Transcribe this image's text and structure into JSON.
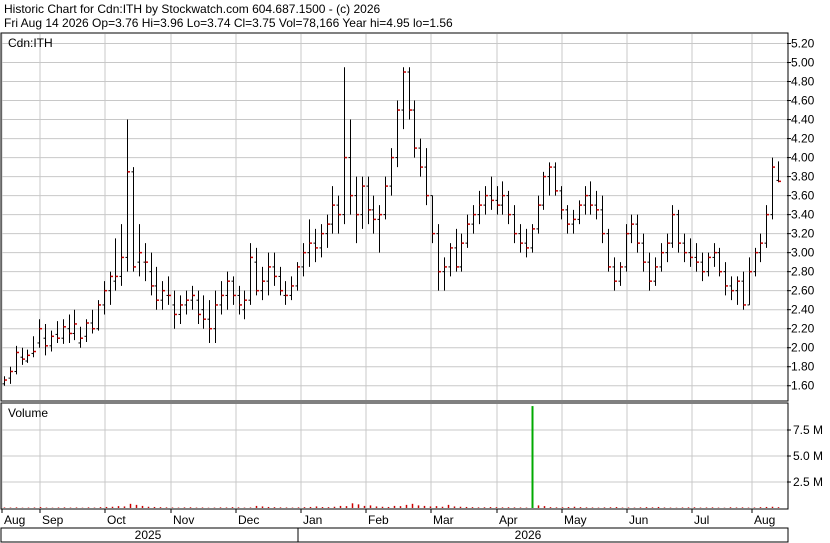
{
  "header": {
    "line1": "Historic Chart for Cdn:ITH by Stockwatch.com 604.687.1500 - (c) 2026",
    "line2": "Fri Aug 14 2026  Op=3.76  Hi=3.96  Lo=3.74  Cl=3.75  Vol=78,166  Year hi=4.95  lo=1.56"
  },
  "colors": {
    "up": "#000000",
    "close_tick": "#cc0000",
    "grid": "#c8c8c8",
    "volume_bar": "#cc0000",
    "volume_spike": "#00aa00"
  },
  "chart_data": [
    {
      "type": "ohlc",
      "title": "Cdn:ITH",
      "ylim": [
        1.45,
        5.3
      ],
      "yticks": [
        "5.20",
        "5.00",
        "4.80",
        "4.60",
        "4.40",
        "4.20",
        "4.00",
        "3.80",
        "3.60",
        "3.40",
        "3.20",
        "3.00",
        "2.80",
        "2.60",
        "2.40",
        "2.20",
        "2.00",
        "1.80",
        "1.60"
      ],
      "grid": true,
      "x_month_labels": [
        "Aug",
        "Sep",
        "Oct",
        "Nov",
        "Dec",
        "Jan",
        "Feb",
        "Mar",
        "Apr",
        "May",
        "Jun",
        "Jul",
        "Aug"
      ],
      "x_year_labels": [
        "2025",
        "2026"
      ],
      "series": [
        {
          "values": [
            [
              1.62,
              1.7,
              1.6,
              1.66
            ],
            [
              1.68,
              1.8,
              1.62,
              1.75
            ],
            [
              1.75,
              2.02,
              1.72,
              1.95
            ],
            [
              1.9,
              2.0,
              1.82,
              1.88
            ],
            [
              1.86,
              1.98,
              1.84,
              1.92
            ],
            [
              1.94,
              2.12,
              1.9,
              1.96
            ],
            [
              2.05,
              2.3,
              2.0,
              2.2
            ],
            [
              2.1,
              2.25,
              1.92,
              2.02
            ],
            [
              2.02,
              2.18,
              1.96,
              2.12
            ],
            [
              2.14,
              2.28,
              2.05,
              2.1
            ],
            [
              2.1,
              2.3,
              2.04,
              2.22
            ],
            [
              2.2,
              2.35,
              2.05,
              2.15
            ],
            [
              2.15,
              2.4,
              2.08,
              2.25
            ],
            [
              2.05,
              2.22,
              2.0,
              2.1
            ],
            [
              2.12,
              2.3,
              2.06,
              2.26
            ],
            [
              2.26,
              2.4,
              2.15,
              2.2
            ],
            [
              2.2,
              2.5,
              2.18,
              2.45
            ],
            [
              2.45,
              2.7,
              2.35,
              2.6
            ],
            [
              2.6,
              2.8,
              2.45,
              2.75
            ],
            [
              2.7,
              3.15,
              2.6,
              2.75
            ],
            [
              2.75,
              3.3,
              2.65,
              2.95
            ],
            [
              2.95,
              4.4,
              2.8,
              3.85
            ],
            [
              3.85,
              3.9,
              2.8,
              2.85
            ],
            [
              2.9,
              3.3,
              2.75,
              3.0
            ],
            [
              2.9,
              3.1,
              2.7,
              2.9
            ],
            [
              2.8,
              3.0,
              2.55,
              2.65
            ],
            [
              2.65,
              2.85,
              2.4,
              2.5
            ],
            [
              2.5,
              2.7,
              2.4,
              2.6
            ],
            [
              2.55,
              2.75,
              2.45,
              2.55
            ],
            [
              2.45,
              2.6,
              2.2,
              2.35
            ],
            [
              2.35,
              2.55,
              2.25,
              2.45
            ],
            [
              2.45,
              2.6,
              2.35,
              2.5
            ],
            [
              2.5,
              2.65,
              2.4,
              2.55
            ],
            [
              2.5,
              2.6,
              2.25,
              2.35
            ],
            [
              2.4,
              2.55,
              2.2,
              2.3
            ],
            [
              2.3,
              2.5,
              2.05,
              2.2
            ],
            [
              2.2,
              2.6,
              2.05,
              2.45
            ],
            [
              2.45,
              2.7,
              2.35,
              2.55
            ],
            [
              2.55,
              2.8,
              2.4,
              2.7
            ],
            [
              2.7,
              2.75,
              2.45,
              2.55
            ],
            [
              2.55,
              2.65,
              2.35,
              2.45
            ],
            [
              2.4,
              2.6,
              2.3,
              2.5
            ],
            [
              2.5,
              3.1,
              2.45,
              2.95
            ],
            [
              2.9,
              3.05,
              2.55,
              2.6
            ],
            [
              2.6,
              2.85,
              2.5,
              2.7
            ],
            [
              2.7,
              3.0,
              2.55,
              2.85
            ],
            [
              2.85,
              3.0,
              2.65,
              2.75
            ],
            [
              2.75,
              2.85,
              2.55,
              2.6
            ],
            [
              2.55,
              2.7,
              2.45,
              2.55
            ],
            [
              2.55,
              2.75,
              2.5,
              2.65
            ],
            [
              2.65,
              2.9,
              2.6,
              2.85
            ],
            [
              2.85,
              3.1,
              2.75,
              3.0
            ],
            [
              3.0,
              3.35,
              2.85,
              3.1
            ],
            [
              3.1,
              3.25,
              2.9,
              3.05
            ],
            [
              3.05,
              3.3,
              2.95,
              3.2
            ],
            [
              3.2,
              3.4,
              3.05,
              3.3
            ],
            [
              3.3,
              3.7,
              3.2,
              3.5
            ],
            [
              3.5,
              3.6,
              3.2,
              3.4
            ],
            [
              3.4,
              4.95,
              3.3,
              4.0
            ],
            [
              4.0,
              4.4,
              3.4,
              3.6
            ],
            [
              3.6,
              3.8,
              3.1,
              3.4
            ],
            [
              3.4,
              3.8,
              3.25,
              3.7
            ],
            [
              3.7,
              3.8,
              3.3,
              3.45
            ],
            [
              3.45,
              3.6,
              3.2,
              3.35
            ],
            [
              3.35,
              3.5,
              3.0,
              3.4
            ],
            [
              3.4,
              3.8,
              3.35,
              3.7
            ],
            [
              3.7,
              4.1,
              3.6,
              4.0
            ],
            [
              4.0,
              4.6,
              3.9,
              4.5
            ],
            [
              4.5,
              4.95,
              4.3,
              4.9
            ],
            [
              4.9,
              4.95,
              4.4,
              4.5
            ],
            [
              4.5,
              4.6,
              4.0,
              4.1
            ],
            [
              4.1,
              4.2,
              3.8,
              3.9
            ],
            [
              3.9,
              4.1,
              3.5,
              3.6
            ],
            [
              3.6,
              3.6,
              3.1,
              3.2
            ],
            [
              3.2,
              3.3,
              2.6,
              2.8
            ],
            [
              2.8,
              2.95,
              2.6,
              2.85
            ],
            [
              2.85,
              3.1,
              2.75,
              3.05
            ],
            [
              3.05,
              3.25,
              2.8,
              2.85
            ],
            [
              2.85,
              3.2,
              2.8,
              3.1
            ],
            [
              3.1,
              3.4,
              3.05,
              3.3
            ],
            [
              3.3,
              3.5,
              3.2,
              3.4
            ],
            [
              3.4,
              3.65,
              3.3,
              3.5
            ],
            [
              3.5,
              3.7,
              3.4,
              3.6
            ],
            [
              3.6,
              3.8,
              3.45,
              3.55
            ],
            [
              3.55,
              3.7,
              3.4,
              3.5
            ],
            [
              3.5,
              3.75,
              3.4,
              3.6
            ],
            [
              3.6,
              3.65,
              3.3,
              3.4
            ],
            [
              3.4,
              3.5,
              3.1,
              3.2
            ],
            [
              3.2,
              3.3,
              3.0,
              3.1
            ],
            [
              3.1,
              3.25,
              2.95,
              3.05
            ],
            [
              3.05,
              3.3,
              3.0,
              3.25
            ],
            [
              3.25,
              3.6,
              3.2,
              3.5
            ],
            [
              3.5,
              3.85,
              3.45,
              3.8
            ],
            [
              3.8,
              3.95,
              3.6,
              3.9
            ],
            [
              3.9,
              3.95,
              3.6,
              3.65
            ],
            [
              3.65,
              3.7,
              3.35,
              3.45
            ],
            [
              3.45,
              3.5,
              3.2,
              3.3
            ],
            [
              3.3,
              3.45,
              3.2,
              3.35
            ],
            [
              3.35,
              3.55,
              3.3,
              3.5
            ],
            [
              3.5,
              3.7,
              3.4,
              3.6
            ],
            [
              3.6,
              3.75,
              3.4,
              3.5
            ],
            [
              3.5,
              3.65,
              3.35,
              3.45
            ],
            [
              3.45,
              3.6,
              3.1,
              3.2
            ],
            [
              3.2,
              3.25,
              2.8,
              2.85
            ],
            [
              2.85,
              2.95,
              2.6,
              2.7
            ],
            [
              2.7,
              2.9,
              2.65,
              2.85
            ],
            [
              2.85,
              3.3,
              2.8,
              3.2
            ],
            [
              3.2,
              3.4,
              3.1,
              3.3
            ],
            [
              3.3,
              3.4,
              3.0,
              3.1
            ],
            [
              3.1,
              3.2,
              2.8,
              2.9
            ],
            [
              2.9,
              3.0,
              2.6,
              2.7
            ],
            [
              2.7,
              2.95,
              2.65,
              2.85
            ],
            [
              2.85,
              3.1,
              2.8,
              3.0
            ],
            [
              3.0,
              3.2,
              2.9,
              3.1
            ],
            [
              3.1,
              3.5,
              3.05,
              3.4
            ],
            [
              3.4,
              3.45,
              3.0,
              3.1
            ],
            [
              3.1,
              3.2,
              2.9,
              3.0
            ],
            [
              3.0,
              3.15,
              2.85,
              2.95
            ],
            [
              2.95,
              3.1,
              2.8,
              2.9
            ],
            [
              2.9,
              3.0,
              2.7,
              2.8
            ],
            [
              2.8,
              3.0,
              2.75,
              2.95
            ],
            [
              2.95,
              3.1,
              2.85,
              3.0
            ],
            [
              3.0,
              3.05,
              2.75,
              2.8
            ],
            [
              2.8,
              2.9,
              2.55,
              2.65
            ],
            [
              2.65,
              2.75,
              2.5,
              2.6
            ],
            [
              2.6,
              2.75,
              2.45,
              2.7
            ],
            [
              2.7,
              2.8,
              2.4,
              2.45
            ],
            [
              2.45,
              2.95,
              2.45,
              2.8
            ],
            [
              2.8,
              3.05,
              2.75,
              3.0
            ],
            [
              3.0,
              3.2,
              2.9,
              3.1
            ],
            [
              3.1,
              3.5,
              3.05,
              3.4
            ],
            [
              3.4,
              4.0,
              3.35,
              3.9
            ],
            [
              3.76,
              3.96,
              3.74,
              3.75
            ]
          ]
        }
      ]
    },
    {
      "type": "bar",
      "title": "Volume",
      "yticks": [
        "7.5 M",
        "5.0 M",
        "2.5 M"
      ],
      "ylim": [
        0,
        10000000
      ],
      "grid": true,
      "series": [
        {
          "values": [
            50000,
            40000,
            60000,
            30000,
            40000,
            50000,
            90000,
            40000,
            30000,
            50000,
            60000,
            40000,
            50000,
            30000,
            60000,
            40000,
            80000,
            100000,
            120000,
            180000,
            150000,
            400000,
            300000,
            200000,
            120000,
            100000,
            80000,
            60000,
            50000,
            40000,
            60000,
            70000,
            40000,
            50000,
            30000,
            40000,
            60000,
            50000,
            80000,
            60000,
            40000,
            50000,
            200000,
            150000,
            100000,
            80000,
            60000,
            50000,
            40000,
            60000,
            80000,
            100000,
            150000,
            90000,
            80000,
            120000,
            200000,
            180000,
            450000,
            350000,
            200000,
            250000,
            150000,
            120000,
            100000,
            200000,
            180000,
            300000,
            400000,
            250000,
            200000,
            150000,
            180000,
            120000,
            300000,
            150000,
            120000,
            100000,
            80000,
            60000,
            70000,
            90000,
            80000,
            60000,
            70000,
            60000,
            50000,
            40000,
            9800000,
            250000,
            180000,
            80000,
            60000,
            70000,
            90000,
            120000,
            80000,
            60000,
            50000,
            40000,
            60000,
            70000,
            90000,
            40000,
            50000,
            40000,
            60000,
            80000,
            60000,
            100000,
            50000,
            40000,
            30000,
            50000,
            60000,
            70000,
            40000,
            50000,
            60000,
            40000,
            30000,
            70000,
            50000,
            60000,
            40000,
            50000,
            80000,
            100000,
            120000,
            78166
          ]
        }
      ]
    }
  ]
}
